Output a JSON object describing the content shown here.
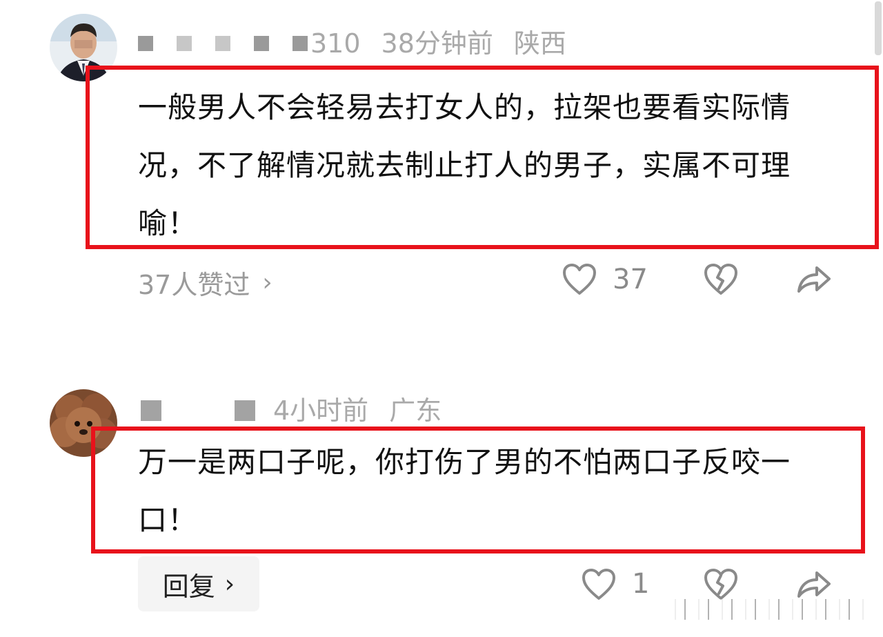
{
  "comments": [
    {
      "username_suffix": "310",
      "time": "38分钟前",
      "location": "陕西",
      "text": "一般男人不会轻易去打女人的，拉架也要看实际情况，不了解情况就去制止打人的男子，实属不可理喻！",
      "likes_summary": "37人赞过",
      "like_count": "37"
    },
    {
      "time": "4小时前",
      "location": "广东",
      "text": "万一是两口子呢，你打伤了男的不怕两口子反咬一口！",
      "reply_label": "回复",
      "like_count": "1"
    }
  ],
  "icons": {
    "like": "heart-icon",
    "dislike": "broken-heart-icon",
    "share": "share-arrow-icon",
    "more": "chevron-right-icon"
  },
  "colors": {
    "highlight_border": "#e8121b",
    "meta_text": "#a9a9a9",
    "body_text": "#111111"
  }
}
